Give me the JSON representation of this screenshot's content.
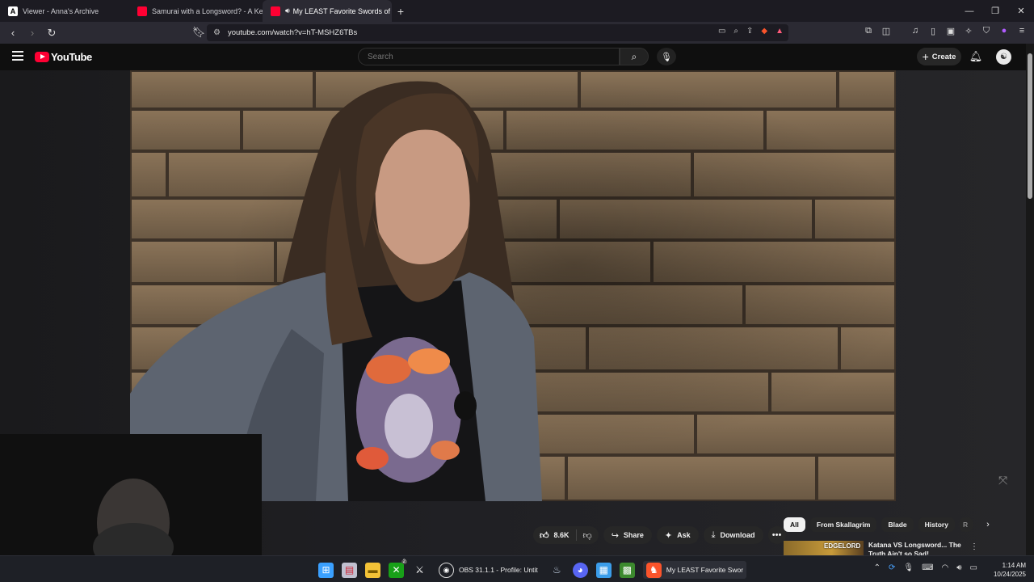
{
  "browser": {
    "tabs": [
      {
        "title": "Viewer - Anna's Archive",
        "active": false
      },
      {
        "title": "Samurai with a Longsword? - A Kenj",
        "active": false
      },
      {
        "title": "My LEAST Favorite Swords of",
        "active": true
      }
    ],
    "url": "youtube.com/watch?v=hT-MSHZ6TBs",
    "new_tab_symbol": "+",
    "close_symbol": "×"
  },
  "youtube": {
    "logo_text": "YouTube",
    "search_placeholder": "Search",
    "create_label": "Create"
  },
  "actions": {
    "likes": "8.6K",
    "share_label": "Share",
    "ask_label": "Ask",
    "download_label": "Download"
  },
  "chips": [
    "All",
    "From Skallagrim",
    "Blade",
    "History",
    "R"
  ],
  "recommendation": {
    "thumb_text": "EDGELORD",
    "title": "Katana VS Longsword... The Truth Ain't so Sad! (Response t"
  },
  "taskbar": {
    "obs_label": "OBS 31.1.1 - Profile: Untit",
    "browser_label": "My LEAST Favorite Swor",
    "xbox_badge": "2",
    "time": "1:14 AM",
    "date": "10/24/2025"
  },
  "colors": {
    "yt_red": "#ff0033",
    "page_bg": "#0f0f0f",
    "chip_bg": "#272727"
  }
}
